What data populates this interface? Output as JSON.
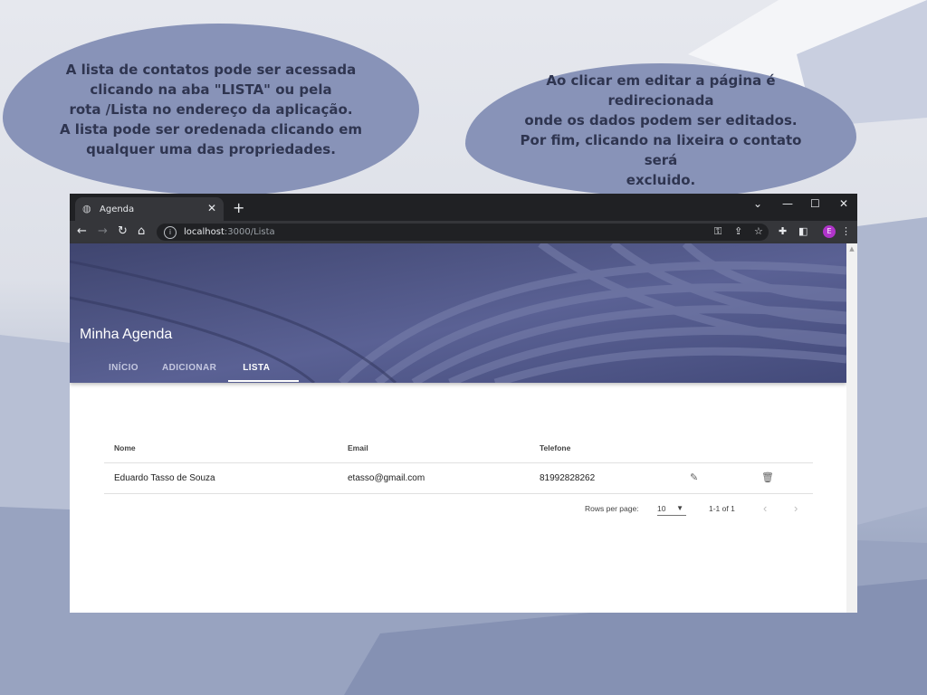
{
  "callouts": {
    "left": "A lista de contatos pode ser acessada\nclicando na  aba \"LISTA\" ou pela\nrota /Lista no endereço da aplicação.\nA lista pode ser oredenada clicando em\nqualquer uma das propriedades.",
    "right": "Ao clicar em editar a página é redirecionada\nonde os dados podem ser editados.\nPor fim, clicando na lixeira o contato será\nexcluido."
  },
  "browser": {
    "tab_title": "Agenda",
    "url_host": "localhost",
    "url_path": ":3000/Lista",
    "profile_initial": "E",
    "profile_color": "#b034c9"
  },
  "app": {
    "title": "Minha Agenda",
    "tabs": [
      {
        "label": "INÍCIO",
        "active": false
      },
      {
        "label": "ADICIONAR",
        "active": false
      },
      {
        "label": "LISTA",
        "active": true
      }
    ],
    "accent": "#4b5181"
  },
  "table": {
    "columns": [
      "Nome",
      "Email",
      "Telefone"
    ],
    "rows": [
      {
        "nome": "Eduardo Tasso de Souza",
        "email": "etasso@gmail.com",
        "telefone": "81992828262"
      }
    ],
    "row_icons": [
      "pencil-icon",
      "trash-icon"
    ]
  },
  "pagination": {
    "rows_per_page_label": "Rows per page:",
    "rows_per_page_value": "10",
    "range": "1-1 of 1"
  }
}
